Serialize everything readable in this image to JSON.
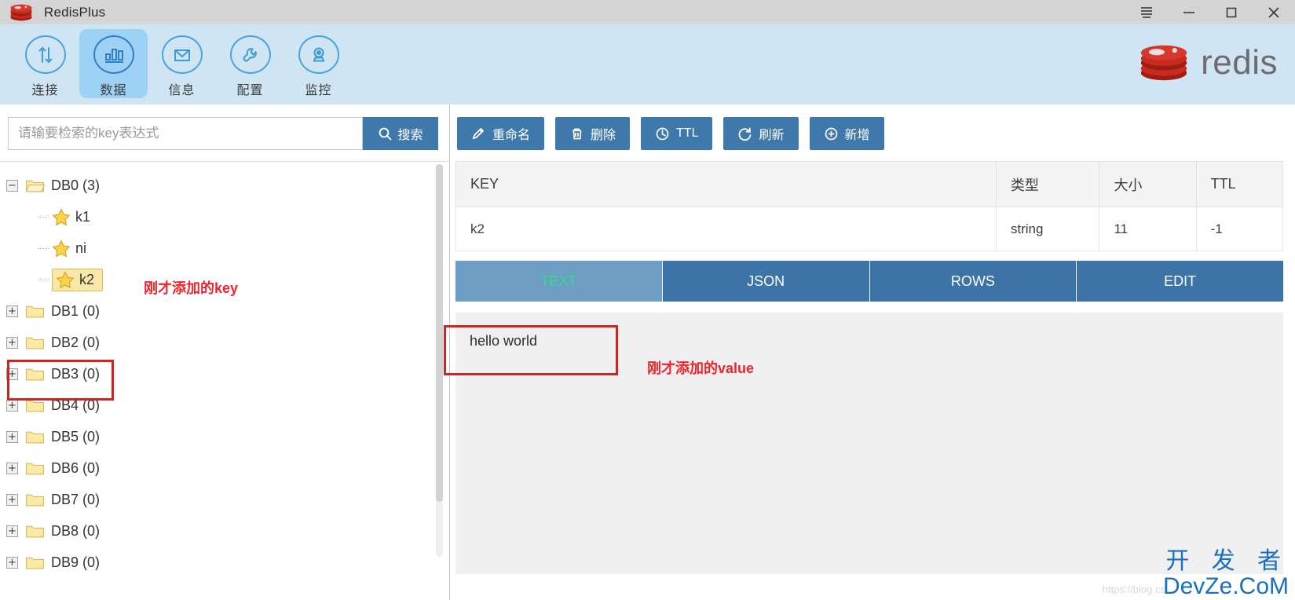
{
  "window": {
    "title": "RedisPlus",
    "app_icon": "redis-stack-icon",
    "controls": [
      {
        "name": "menu-button",
        "icon": "hamburger-menu-icon"
      },
      {
        "name": "minimize-button",
        "icon": "minimize-icon"
      },
      {
        "name": "maximize-button",
        "icon": "maximize-icon"
      },
      {
        "name": "close-button",
        "icon": "close-icon"
      }
    ]
  },
  "navbar": {
    "brand_text": "redis",
    "brand_icon": "redis-stack-icon",
    "items": [
      {
        "label": "连接",
        "icon": "transfer-arrows-icon",
        "active": false
      },
      {
        "label": "数据",
        "icon": "bar-chart-icon",
        "active": true
      },
      {
        "label": "信息",
        "icon": "envelope-icon",
        "active": false
      },
      {
        "label": "配置",
        "icon": "wrench-icon",
        "active": false
      },
      {
        "label": "监控",
        "icon": "monitor-camera-icon",
        "active": false
      }
    ]
  },
  "search": {
    "placeholder": "请输要检索的key表达式",
    "value": "",
    "button_label": "搜索",
    "button_icon": "search-icon"
  },
  "tree": {
    "nodes": [
      {
        "label": "DB0 (3)",
        "state": "expanded",
        "icon": "folder-open-icon",
        "level": 0,
        "selected": false
      },
      {
        "label": "k1",
        "state": "leaf",
        "icon": "star-icon",
        "level": 1,
        "selected": false
      },
      {
        "label": "ni",
        "state": "leaf",
        "icon": "star-icon",
        "level": 1,
        "selected": false
      },
      {
        "label": "k2",
        "state": "leaf",
        "icon": "star-icon",
        "level": 1,
        "selected": true
      },
      {
        "label": "DB1 (0)",
        "state": "collapsed",
        "icon": "folder-icon",
        "level": 0,
        "selected": false
      },
      {
        "label": "DB2 (0)",
        "state": "collapsed",
        "icon": "folder-icon",
        "level": 0,
        "selected": false
      },
      {
        "label": "DB3 (0)",
        "state": "collapsed",
        "icon": "folder-icon",
        "level": 0,
        "selected": false
      },
      {
        "label": "DB4 (0)",
        "state": "collapsed",
        "icon": "folder-icon",
        "level": 0,
        "selected": false
      },
      {
        "label": "DB5 (0)",
        "state": "collapsed",
        "icon": "folder-icon",
        "level": 0,
        "selected": false
      },
      {
        "label": "DB6 (0)",
        "state": "collapsed",
        "icon": "folder-icon",
        "level": 0,
        "selected": false
      },
      {
        "label": "DB7 (0)",
        "state": "collapsed",
        "icon": "folder-icon",
        "level": 0,
        "selected": false
      },
      {
        "label": "DB8 (0)",
        "state": "collapsed",
        "icon": "folder-icon",
        "level": 0,
        "selected": false
      },
      {
        "label": "DB9 (0)",
        "state": "collapsed",
        "icon": "folder-icon",
        "level": 0,
        "selected": false
      }
    ],
    "expander_expanded_glyph": "−",
    "expander_collapsed_glyph": "+"
  },
  "actions": [
    {
      "label": "重命名",
      "icon": "pencil-icon"
    },
    {
      "label": "删除",
      "icon": "trash-icon"
    },
    {
      "label": "TTL",
      "icon": "clock-icon"
    },
    {
      "label": "刷新",
      "icon": "refresh-icon"
    },
    {
      "label": "新增",
      "icon": "plus-circle-icon"
    }
  ],
  "key_table": {
    "headers": [
      "KEY",
      "类型",
      "大小",
      "TTL"
    ],
    "rows": [
      {
        "key": "k2",
        "type": "string",
        "size": "11",
        "ttl": "-1"
      }
    ]
  },
  "value_tabs": [
    {
      "label": "TEXT",
      "active": true
    },
    {
      "label": "JSON",
      "active": false
    },
    {
      "label": "ROWS",
      "active": false
    },
    {
      "label": "EDIT",
      "active": false
    }
  ],
  "value_pane": {
    "text": "hello world"
  },
  "annotations": [
    {
      "id": "key",
      "text": "刚才添加的key",
      "color": "#f0242c"
    },
    {
      "id": "val",
      "text": "刚才添加的value",
      "color": "#f0242c"
    }
  ],
  "watermark": {
    "line_cn": "开 发 者",
    "line_en": "DevZe.CoM",
    "url": "https://blog.cs"
  },
  "colors": {
    "titlebar": "#d4d4d4",
    "navbar": "#cfe5f4",
    "nav_active": "#9ed2f5",
    "accent_blue": "#3f79ac",
    "tab_active_bg": "#6e9ec4",
    "tab_active_text": "#2fe08a",
    "annotation_red": "#cf2424",
    "selection_yellow": "#fbe8a8",
    "redis_red": "#c62a20"
  }
}
